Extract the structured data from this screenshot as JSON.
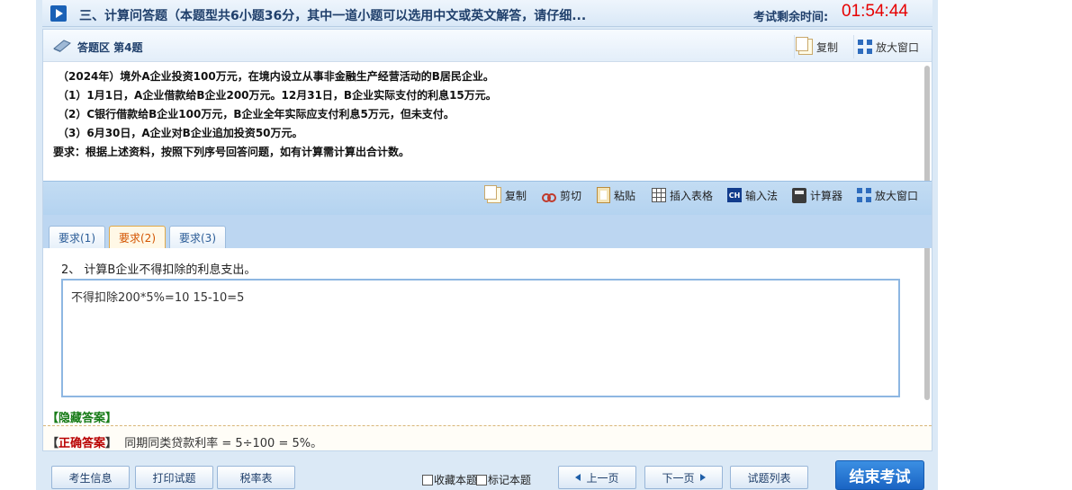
{
  "header": {
    "section_title": "三、计算问答题（本题型共6小题36分，其中一道小题可以选用中文或英文解答，请仔细...",
    "timer_label": "考试剩余时间:",
    "timer_value": "01:54:44"
  },
  "answer_panel": {
    "title": "答题区 第4题",
    "copy_label": "复制",
    "maximize_label": "放大窗口"
  },
  "question": {
    "lines": [
      "（2024年）境外A企业投资100万元，在境内设立从事非金融生产经营活动的B居民企业。",
      "（1）1月1日，A企业借款给B企业200万元。12月31日，B企业实际支付的利息15万元。",
      "（2）C银行借款给B企业100万元，B企业全年实际应支付利息5万元，但未支付。",
      "（3）6月30日，A企业对B企业追加投资50万元。",
      "要求：根据上述资料，按照下列序号回答问题，如有计算需计算出合计数。"
    ]
  },
  "toolbar": {
    "copy": "复制",
    "cut": "剪切",
    "paste": "粘贴",
    "insert_table": "插入表格",
    "ime_icon": "CH",
    "ime": "输入法",
    "calculator": "计算器",
    "maximize": "放大窗口"
  },
  "tabs": [
    {
      "label": "要求(1)",
      "active": false
    },
    {
      "label": "要求(2)",
      "active": true
    },
    {
      "label": "要求(3)",
      "active": false
    }
  ],
  "sub_question": "2、 计算B企业不得扣除的利息支出。",
  "answer_text": "不得扣除200*5%=10  15-10=5",
  "hide_answer": "【隐藏答案】",
  "correct_answer": {
    "open": "【",
    "label": "正确答案",
    "close": "】",
    "text": "同期同类贷款利率 = 5÷100 = 5%。"
  },
  "footer": {
    "candidate_info": "考生信息",
    "print": "打印试题",
    "tax_table": "税率表",
    "favorite": "收藏本题",
    "mark": "标记本题",
    "prev": "上一页",
    "next": "下一页",
    "list": "试题列表",
    "end_exam": "结束考试"
  },
  "colors": {
    "timer": "#e60000",
    "accent": "#1a64c4",
    "active_tab": "#d35400",
    "correct_label": "#b90000",
    "hide_answer": "#177b17"
  }
}
